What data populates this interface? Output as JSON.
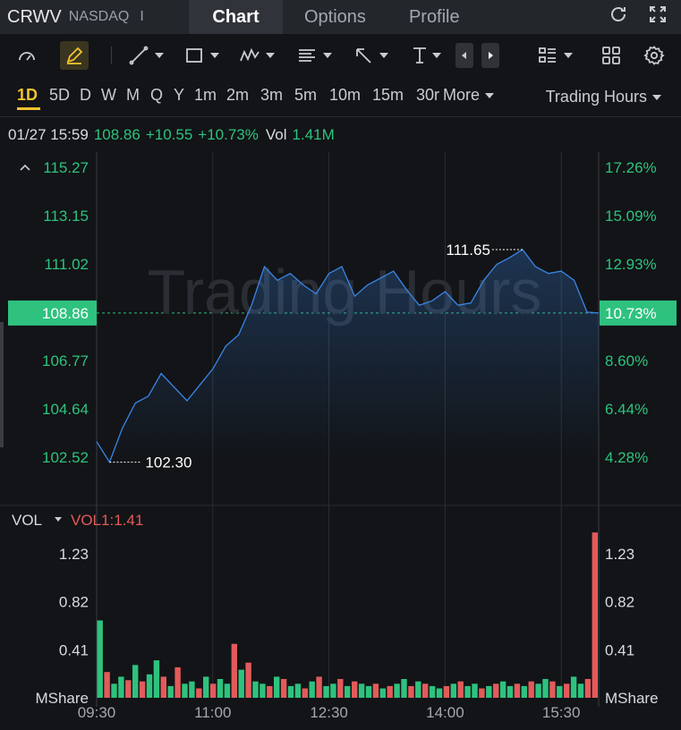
{
  "header": {
    "ticker": "CRWV",
    "exchange": "NASDAQ",
    "separator": "I",
    "tabs": [
      {
        "label": "Chart",
        "active": true
      },
      {
        "label": "Options",
        "active": false
      },
      {
        "label": "Profile",
        "active": false
      }
    ]
  },
  "periods": {
    "items": [
      "1D",
      "5D",
      "D",
      "W",
      "M",
      "Q",
      "Y",
      "1m",
      "2m",
      "3m",
      "5m",
      "10m",
      "15m",
      "30r"
    ],
    "active": "1D",
    "more_label": "More",
    "session_label": "Trading Hours"
  },
  "quote": {
    "timestamp": "01/27 15:59",
    "price": "108.86",
    "change": "+10.55",
    "change_pct": "+10.73%",
    "vol_label": "Vol",
    "vol_value": "1.41M"
  },
  "price_axis": {
    "left_ticks": [
      "115.27",
      "113.15",
      "111.02",
      "108.86",
      "106.77",
      "104.64",
      "102.52"
    ],
    "right_ticks": [
      "17.26%",
      "15.09%",
      "12.93%",
      "10.73%",
      "8.60%",
      "6.44%",
      "4.28%"
    ],
    "current_price_label": "108.86",
    "current_pct_label": "10.73%",
    "high_label": "111.65",
    "low_label": "102.30",
    "watermark": "Trading Hours"
  },
  "volume": {
    "indicator_label": "VOL",
    "value_label": "VOL1:1.41",
    "ticks": [
      "1.23",
      "0.82",
      "0.41"
    ],
    "unit": "MShare"
  },
  "time_axis": [
    "09:30",
    "11:00",
    "12:30",
    "14:00",
    "15:30"
  ],
  "colors": {
    "up": "#2ec27e",
    "down": "#e35a5a",
    "line": "#3a86e6",
    "accent": "#f2c230",
    "badge": "#2ec27e"
  },
  "chart_data": {
    "type": "line",
    "title": "",
    "xlabel": "",
    "ylabel": "",
    "ylim": [
      102.52,
      115.27
    ],
    "x": [
      "09:30",
      "09:40",
      "09:50",
      "10:00",
      "10:10",
      "10:20",
      "10:30",
      "10:40",
      "10:50",
      "11:00",
      "11:10",
      "11:20",
      "11:30",
      "11:40",
      "11:50",
      "12:00",
      "12:10",
      "12:20",
      "12:30",
      "12:40",
      "12:50",
      "13:00",
      "13:10",
      "13:20",
      "13:30",
      "13:40",
      "13:50",
      "14:00",
      "14:10",
      "14:20",
      "14:30",
      "14:40",
      "14:50",
      "15:00",
      "15:10",
      "15:20",
      "15:30",
      "15:40",
      "15:50",
      "15:59"
    ],
    "series": [
      {
        "values": [
          103.2,
          102.3,
          103.8,
          104.9,
          105.2,
          106.2,
          105.6,
          105.0,
          105.7,
          106.4,
          107.4,
          107.9,
          109.2,
          110.9,
          110.3,
          110.6,
          110.1,
          109.7,
          110.6,
          110.9,
          109.6,
          110.1,
          110.4,
          110.7,
          109.9,
          109.2,
          109.4,
          109.8,
          109.2,
          109.3,
          110.3,
          111.0,
          111.3,
          111.65,
          110.9,
          110.6,
          110.7,
          110.3,
          108.9,
          108.86
        ]
      }
    ],
    "volume": {
      "ylim": [
        0,
        1.45
      ],
      "unit": "MShare",
      "values": [
        0.66,
        0.22,
        0.12,
        0.18,
        0.15,
        0.28,
        0.14,
        0.2,
        0.32,
        0.18,
        0.1,
        0.26,
        0.12,
        0.14,
        0.08,
        0.18,
        0.12,
        0.16,
        0.12,
        0.46,
        0.24,
        0.3,
        0.14,
        0.12,
        0.1,
        0.18,
        0.16,
        0.1,
        0.12,
        0.08,
        0.14,
        0.18,
        0.1,
        0.12,
        0.16,
        0.1,
        0.14,
        0.12,
        0.1,
        0.12,
        0.08,
        0.1,
        0.12,
        0.16,
        0.1,
        0.14,
        0.12,
        0.1,
        0.08,
        0.1,
        0.12,
        0.14,
        0.1,
        0.12,
        0.08,
        0.1,
        0.12,
        0.14,
        0.1,
        0.12,
        0.1,
        0.14,
        0.12,
        0.16,
        0.14,
        0.1,
        0.12,
        0.18,
        0.12,
        0.16,
        1.41
      ]
    }
  }
}
